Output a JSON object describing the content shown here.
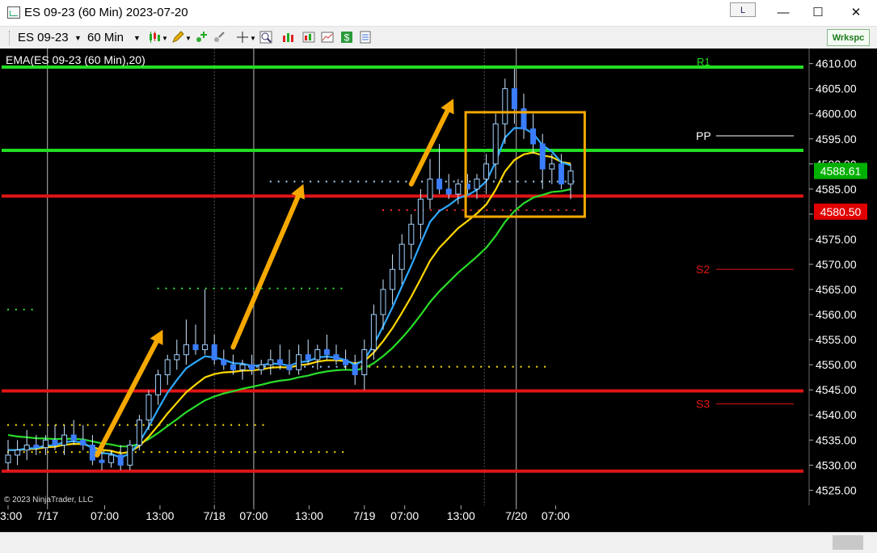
{
  "window": {
    "title": "ES 09-23 (60 Min)  2023-07-20",
    "link_label": "L",
    "minimize": "—",
    "maximize": "☐",
    "close": "✕"
  },
  "toolbar": {
    "instrument": "ES 09-23",
    "interval": "60 Min",
    "workspace": "Wrkspc"
  },
  "chart_data": {
    "type": "candlestick",
    "indicator_label": "EMA(ES 09-23 (60 Min),20)",
    "copyright": "© 2023 NinjaTrader, LLC",
    "ylim": [
      4522,
      4613
    ],
    "y_ticks": [
      "4610.00",
      "4605.00",
      "4600.00",
      "4595.00",
      "4590.00",
      "4585.00",
      "4580.00",
      "4575.00",
      "4570.00",
      "4565.00",
      "4560.00",
      "4555.00",
      "4550.00",
      "4545.00",
      "4540.00",
      "4535.00",
      "4530.00",
      "4525.00"
    ],
    "y_tick_values": [
      4610,
      4605,
      4600,
      4595,
      4590,
      4585,
      4580,
      4575,
      4570,
      4565,
      4560,
      4555,
      4550,
      4545,
      4540,
      4535,
      4530,
      4525
    ],
    "x_ticks": [
      "3:00",
      "7/17",
      "07:00",
      "13:00",
      "7/18",
      "07:00",
      "13:00",
      "7/19",
      "07:00",
      "13:00",
      "7/20",
      "07:00"
    ],
    "x_tick_bars": [
      0,
      4.2,
      10.3,
      16.2,
      22.0,
      26.2,
      32.1,
      38.0,
      42.3,
      48.3,
      54.2,
      58.4
    ],
    "price_labels": [
      {
        "text": "4588.61",
        "value": 4588.61,
        "bg": "#00b000"
      },
      {
        "text": "4580.50",
        "value": 4580.5,
        "bg": "#e00000"
      }
    ],
    "pivot_lines": [
      {
        "name": "R1",
        "value": 4609.3,
        "color": "#22dd22",
        "label_visible": true,
        "start_bar": 0
      },
      {
        "name": "",
        "value": 4592.7,
        "color": "#22dd22",
        "label_visible": false,
        "start_bar": 0
      },
      {
        "name": "",
        "value": 4583.6,
        "color": "#e01515",
        "label_visible": false,
        "start_bar": 0
      },
      {
        "name": "",
        "value": 4544.8,
        "color": "#e01515",
        "label_visible": false,
        "start_bar": 0
      },
      {
        "name": "",
        "value": 4528.8,
        "color": "#e01515",
        "label_visible": false,
        "start_bar": 0
      }
    ],
    "pivot_labels": [
      {
        "name": "PP",
        "value": 4595.6,
        "color": "#ffffff"
      },
      {
        "name": "S2",
        "value": 4569.0,
        "color": "#e01515"
      },
      {
        "name": "S3",
        "value": 4542.2,
        "color": "#e01515"
      }
    ],
    "candles": [
      {
        "o": 4530.5,
        "h": 4535,
        "l": 4529,
        "c": 4532
      },
      {
        "o": 4532,
        "h": 4535,
        "l": 4530,
        "c": 4533
      },
      {
        "o": 4533,
        "h": 4537,
        "l": 4531,
        "c": 4534
      },
      {
        "o": 4534,
        "h": 4536,
        "l": 4532,
        "c": 4533.5
      },
      {
        "o": 4533.5,
        "h": 4536,
        "l": 4532,
        "c": 4535
      },
      {
        "o": 4535,
        "h": 4538,
        "l": 4533,
        "c": 4534
      },
      {
        "o": 4534,
        "h": 4538,
        "l": 4532,
        "c": 4536
      },
      {
        "o": 4536,
        "h": 4539,
        "l": 4534,
        "c": 4535
      },
      {
        "o": 4535,
        "h": 4538,
        "l": 4533,
        "c": 4534
      },
      {
        "o": 4534,
        "h": 4536,
        "l": 4530,
        "c": 4531
      },
      {
        "o": 4531,
        "h": 4533,
        "l": 4529,
        "c": 4530.5
      },
      {
        "o": 4530.5,
        "h": 4533,
        "l": 4529.5,
        "c": 4532
      },
      {
        "o": 4532,
        "h": 4534,
        "l": 4529,
        "c": 4530
      },
      {
        "o": 4530,
        "h": 4535,
        "l": 4529,
        "c": 4534
      },
      {
        "o": 4534,
        "h": 4540,
        "l": 4533,
        "c": 4539
      },
      {
        "o": 4539,
        "h": 4545,
        "l": 4537,
        "c": 4544
      },
      {
        "o": 4544,
        "h": 4549,
        "l": 4542,
        "c": 4548
      },
      {
        "o": 4548,
        "h": 4552,
        "l": 4546,
        "c": 4551
      },
      {
        "o": 4551,
        "h": 4555,
        "l": 4549,
        "c": 4552
      },
      {
        "o": 4552,
        "h": 4559,
        "l": 4550,
        "c": 4554
      },
      {
        "o": 4554,
        "h": 4558,
        "l": 4552,
        "c": 4553
      },
      {
        "o": 4553,
        "h": 4565,
        "l": 4552,
        "c": 4554
      },
      {
        "o": 4554,
        "h": 4556,
        "l": 4550,
        "c": 4551
      },
      {
        "o": 4551,
        "h": 4553,
        "l": 4549,
        "c": 4550
      },
      {
        "o": 4550,
        "h": 4552,
        "l": 4548,
        "c": 4549
      },
      {
        "o": 4549,
        "h": 4551,
        "l": 4547,
        "c": 4550
      },
      {
        "o": 4550,
        "h": 4552,
        "l": 4548,
        "c": 4549
      },
      {
        "o": 4549,
        "h": 4551,
        "l": 4548,
        "c": 4550
      },
      {
        "o": 4550,
        "h": 4553,
        "l": 4548,
        "c": 4551
      },
      {
        "o": 4551,
        "h": 4554,
        "l": 4549,
        "c": 4550
      },
      {
        "o": 4550,
        "h": 4553,
        "l": 4548,
        "c": 4549
      },
      {
        "o": 4549,
        "h": 4554,
        "l": 4548,
        "c": 4552
      },
      {
        "o": 4552,
        "h": 4555,
        "l": 4550,
        "c": 4551
      },
      {
        "o": 4551,
        "h": 4554,
        "l": 4549,
        "c": 4553
      },
      {
        "o": 4553,
        "h": 4556,
        "l": 4551,
        "c": 4552
      },
      {
        "o": 4552,
        "h": 4554,
        "l": 4550,
        "c": 4551
      },
      {
        "o": 4551,
        "h": 4553,
        "l": 4549,
        "c": 4550
      },
      {
        "o": 4550,
        "h": 4552,
        "l": 4546,
        "c": 4548
      },
      {
        "o": 4548,
        "h": 4555,
        "l": 4545,
        "c": 4553
      },
      {
        "o": 4553,
        "h": 4562,
        "l": 4551,
        "c": 4560
      },
      {
        "o": 4560,
        "h": 4567,
        "l": 4557,
        "c": 4565
      },
      {
        "o": 4565,
        "h": 4572,
        "l": 4562,
        "c": 4569
      },
      {
        "o": 4569,
        "h": 4576,
        "l": 4566,
        "c": 4574
      },
      {
        "o": 4574,
        "h": 4580,
        "l": 4571,
        "c": 4578
      },
      {
        "o": 4578,
        "h": 4585,
        "l": 4575,
        "c": 4583
      },
      {
        "o": 4583,
        "h": 4591,
        "l": 4581,
        "c": 4587
      },
      {
        "o": 4587,
        "h": 4594,
        "l": 4584,
        "c": 4585
      },
      {
        "o": 4585,
        "h": 4588,
        "l": 4583,
        "c": 4584
      },
      {
        "o": 4584,
        "h": 4587,
        "l": 4582,
        "c": 4586
      },
      {
        "o": 4586,
        "h": 4588,
        "l": 4584,
        "c": 4585
      },
      {
        "o": 4585,
        "h": 4588,
        "l": 4583,
        "c": 4587
      },
      {
        "o": 4587,
        "h": 4592,
        "l": 4584,
        "c": 4590
      },
      {
        "o": 4590,
        "h": 4600,
        "l": 4587,
        "c": 4598
      },
      {
        "o": 4598,
        "h": 4607,
        "l": 4594,
        "c": 4605
      },
      {
        "o": 4605,
        "h": 4609,
        "l": 4598,
        "c": 4601
      },
      {
        "o": 4601,
        "h": 4604,
        "l": 4595,
        "c": 4597
      },
      {
        "o": 4597,
        "h": 4600,
        "l": 4592,
        "c": 4594
      },
      {
        "o": 4594,
        "h": 4596,
        "l": 4585,
        "c": 4589
      },
      {
        "o": 4589,
        "h": 4592,
        "l": 4586,
        "c": 4590
      },
      {
        "o": 4590,
        "h": 4592,
        "l": 4585,
        "c": 4586
      },
      {
        "o": 4586,
        "h": 4590,
        "l": 4583,
        "c": 4588.61
      }
    ],
    "ema_series": [
      {
        "name": "EMA(ES 09-23 (60 Min),20)",
        "period": 20,
        "color": "#29dd29"
      },
      {
        "name": "",
        "period": 10,
        "color": "#ffd700"
      },
      {
        "name": "",
        "period": 5,
        "color": "#2ea8ff"
      }
    ],
    "arrow_annotations": [
      {
        "from_bar": 9.5,
        "from_value": 4532,
        "to_bar": 16.5,
        "to_value": 4557,
        "color": "#f5a800"
      },
      {
        "from_bar": 24.0,
        "from_value": 4553.5,
        "to_bar": 31.5,
        "to_value": 4586,
        "color": "#f5a800"
      },
      {
        "from_bar": 43.0,
        "from_value": 4586,
        "to_bar": 47.5,
        "to_value": 4603,
        "color": "#f5a800"
      }
    ],
    "highlight_box": {
      "from_bar": 48.8,
      "to_bar": 61.5,
      "from_value": 4579.5,
      "to_value": 4600.3,
      "color": "#f5a800"
    }
  }
}
